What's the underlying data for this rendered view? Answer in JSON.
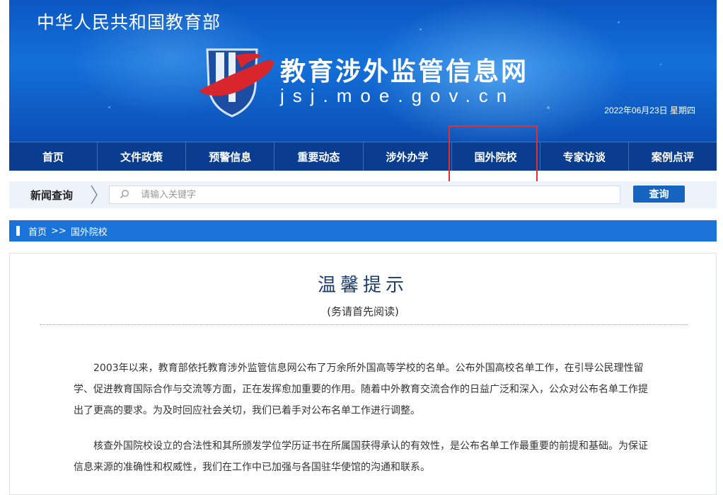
{
  "banner": {
    "ministry_name": "中华人民共和国教育部",
    "site_title": "教育涉外监管信息网",
    "site_domain": "jsj.moe.gov.cn",
    "date": "2022年06月23日",
    "weekday": "星期四"
  },
  "nav": {
    "items": [
      {
        "label": "首页"
      },
      {
        "label": "文件政策"
      },
      {
        "label": "预警信息"
      },
      {
        "label": "重要动态"
      },
      {
        "label": "涉外办学"
      },
      {
        "label": "国外院校"
      },
      {
        "label": "专家访谈"
      },
      {
        "label": "案例点评"
      }
    ],
    "highlighted": "国外院校"
  },
  "search": {
    "label": "新闻查询",
    "placeholder": "请输入关键字",
    "value": "",
    "button_label": "查询"
  },
  "breadcrumb": {
    "home": "首页",
    "separator": ">>",
    "current": "国外院校"
  },
  "notice": {
    "title": "温馨提示",
    "subtitle": "(务请首先阅读)",
    "paragraphs": [
      "2003年以来，教育部依托教育涉外监管信息网公布了万余所外国高等学校的名单。公布外国高校名单工作，在引导公民理性留学、促进教育国际合作与交流等方面，正在发挥愈加重要的作用。随着中外教育交流合作的日益广泛和深入，公众对公布名单工作提出了更高的要求。为及时回应社会关切，我们已着手对公布名单工作进行调整。",
      "核查外国院校设立的合法性和其所颁发学位学历证书在所属国获得承认的有效性，是公布名单工作最重要的前提和基础。为保证信息来源的准确性和权威性，我们在工作中已加强与各国驻华使馆的沟通和联系。"
    ]
  },
  "colors": {
    "nav_background": "#0a3d8f",
    "breadcrumb_background": "#1a73d9",
    "button_background": "#1565c0",
    "highlight_border": "#e03030"
  }
}
